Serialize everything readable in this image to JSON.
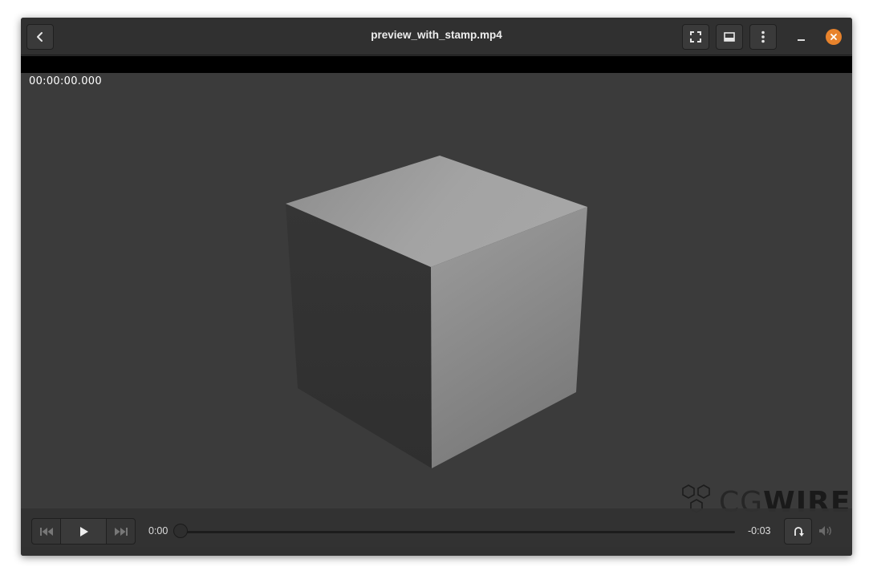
{
  "window": {
    "title": "preview_with_stamp.mp4"
  },
  "header": {
    "back_icon": "chevron-left-icon",
    "fullscreen_icon": "fullscreen-icon",
    "subtitles_icon": "subtitles-icon",
    "menu_icon": "vertical-dots-icon",
    "minimize_icon": "minimize-icon",
    "close_icon": "close-icon",
    "close_color": "#e8832c"
  },
  "video": {
    "timecode": "00:00:00.000",
    "background_color": "#3b3b3b",
    "watermark": {
      "text_light": "CG",
      "text_bold": "WIRE"
    }
  },
  "controls": {
    "position": "0:00",
    "remaining": "-0:03",
    "progress": 0,
    "prev_icon": "skip-previous-icon",
    "play_icon": "play-icon",
    "next_icon": "skip-next-icon",
    "loop_icon": "loop-icon",
    "volume_icon": "volume-muted-icon"
  }
}
